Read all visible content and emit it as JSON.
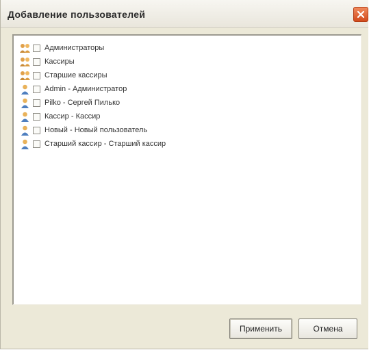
{
  "window": {
    "title": "Добавление пользователей"
  },
  "list": {
    "items": [
      {
        "label": "Администраторы",
        "icon": "group-icon",
        "checked": false
      },
      {
        "label": "Кассиры",
        "icon": "group-icon",
        "checked": false
      },
      {
        "label": "Старшие кассиры",
        "icon": "group-icon",
        "checked": false
      },
      {
        "label": "Admin - Администратор",
        "icon": "user-icon",
        "checked": false
      },
      {
        "label": "Pilko - Сергей Пилько",
        "icon": "user-icon",
        "checked": false
      },
      {
        "label": "Кассир - Кассир",
        "icon": "user-icon",
        "checked": false
      },
      {
        "label": "Новый - Новый пользователь",
        "icon": "user-icon",
        "checked": false
      },
      {
        "label": "Старший кассир - Старший кассир",
        "icon": "user-icon",
        "checked": false
      }
    ]
  },
  "buttons": {
    "apply": "Применить",
    "cancel": "Отмена"
  },
  "colors": {
    "window_bg": "#ece9d8",
    "close_button": "#d24b1d"
  }
}
